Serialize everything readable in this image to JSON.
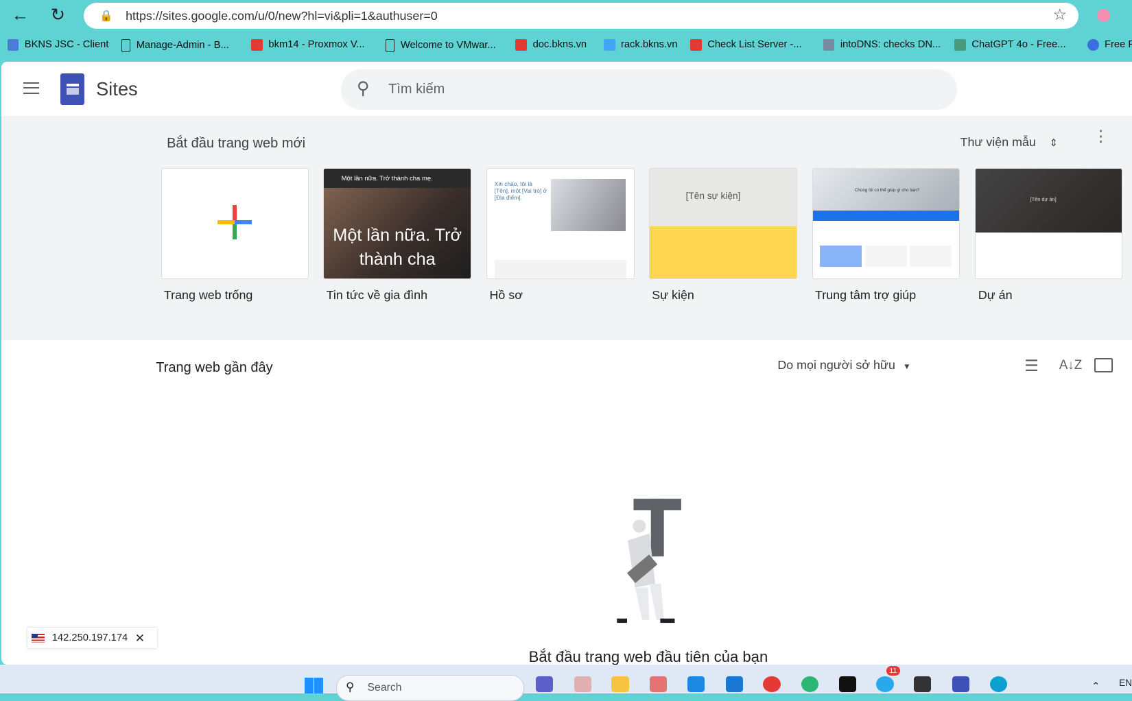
{
  "browser": {
    "url": "https://sites.google.com/u/0/new?hl=vi&pli=1&authuser=0",
    "bookmarks": [
      "BKNS JSC - Client",
      "Manage-Admin - B...",
      "bkm14 - Proxmox V...",
      "Welcome to VMwar...",
      "doc.bkns.vn",
      "rack.bkns.vn",
      "Check List Server -...",
      "intoDNS: checks DN...",
      "ChatGPT 4o - Free...",
      "Free F"
    ]
  },
  "header": {
    "app_name": "Sites",
    "search_placeholder": "Tìm kiếm"
  },
  "gallery": {
    "title": "Bắt đầu trang web mới",
    "template_gallery": "Thư viện mẫu",
    "templates": [
      {
        "label": "Trang web trống"
      },
      {
        "label": "Tin tức về gia đình",
        "thumb": "Một lần nữa. Trở thành cha",
        "thumb_bar": "Một lần nữa. Trở thành cha mẹ."
      },
      {
        "label": "Hồ sơ",
        "thumb": "Xin chào, tôi là [Tên], một [Vai trò] ở [Địa điểm]."
      },
      {
        "label": "Sự kiện",
        "thumb": "[Tên sự kiện]"
      },
      {
        "label": "Trung tâm trợ giúp",
        "thumb": "Chúng tôi có thể giúp gì cho bạn?"
      },
      {
        "label": "Dự án",
        "thumb": "[Tên dự án]"
      }
    ]
  },
  "recent": {
    "title": "Trang web gần đây",
    "owner_filter": "Do mọi người sở hữu",
    "empty_text": "Bắt đầu trang web đầu tiên của bạn"
  },
  "ip_badge": {
    "ip": "142.250.197.174"
  },
  "taskbar": {
    "search": "Search",
    "lang": "EN",
    "telegram_badge": "11"
  }
}
